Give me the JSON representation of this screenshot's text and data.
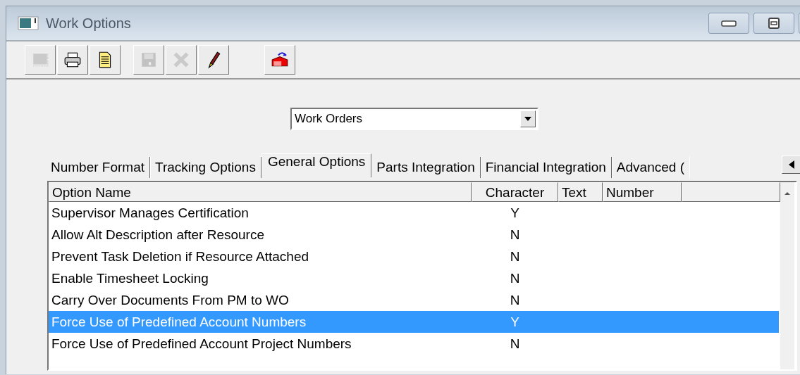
{
  "window": {
    "title": "Work Options",
    "controls": [
      {
        "kind": "minimize"
      },
      {
        "kind": "maximize"
      }
    ]
  },
  "toolbar": [
    {
      "kind": "form",
      "disabled": true
    },
    {
      "kind": "print",
      "disabled": false
    },
    {
      "kind": "report",
      "disabled": false
    },
    {
      "kind": "save",
      "disabled": true
    },
    {
      "kind": "delete",
      "disabled": true
    },
    {
      "kind": "edit",
      "disabled": false
    },
    {
      "kind": "export",
      "disabled": false
    }
  ],
  "module_select": {
    "value": "Work Orders"
  },
  "tabs": [
    {
      "label": "Number Format",
      "selected": false
    },
    {
      "label": "Tracking Options",
      "selected": false
    },
    {
      "label": "General Options",
      "selected": true
    },
    {
      "label": "Parts Integration",
      "selected": false
    },
    {
      "label": "Financial Integration",
      "selected": false
    },
    {
      "label": "Advanced (",
      "selected": false
    }
  ],
  "table": {
    "columns": [
      "Option Name",
      "Character",
      "Text",
      "Number"
    ],
    "rows": [
      {
        "name": "Supervisor Manages Certification",
        "character": "Y",
        "selected": false
      },
      {
        "name": "Allow Alt Description after Resource",
        "character": "N",
        "selected": false
      },
      {
        "name": "Prevent Task Deletion if Resource Attached",
        "character": "N",
        "selected": false
      },
      {
        "name": "Enable Timesheet Locking",
        "character": "N",
        "selected": false
      },
      {
        "name": "Carry Over Documents From PM to WO",
        "character": "N",
        "selected": false
      },
      {
        "name": "Force Use of Predefined Account Numbers",
        "character": "Y",
        "selected": true
      },
      {
        "name": "Force Use of Predefined Account Project Numbers",
        "character": "N",
        "selected": false
      }
    ]
  }
}
